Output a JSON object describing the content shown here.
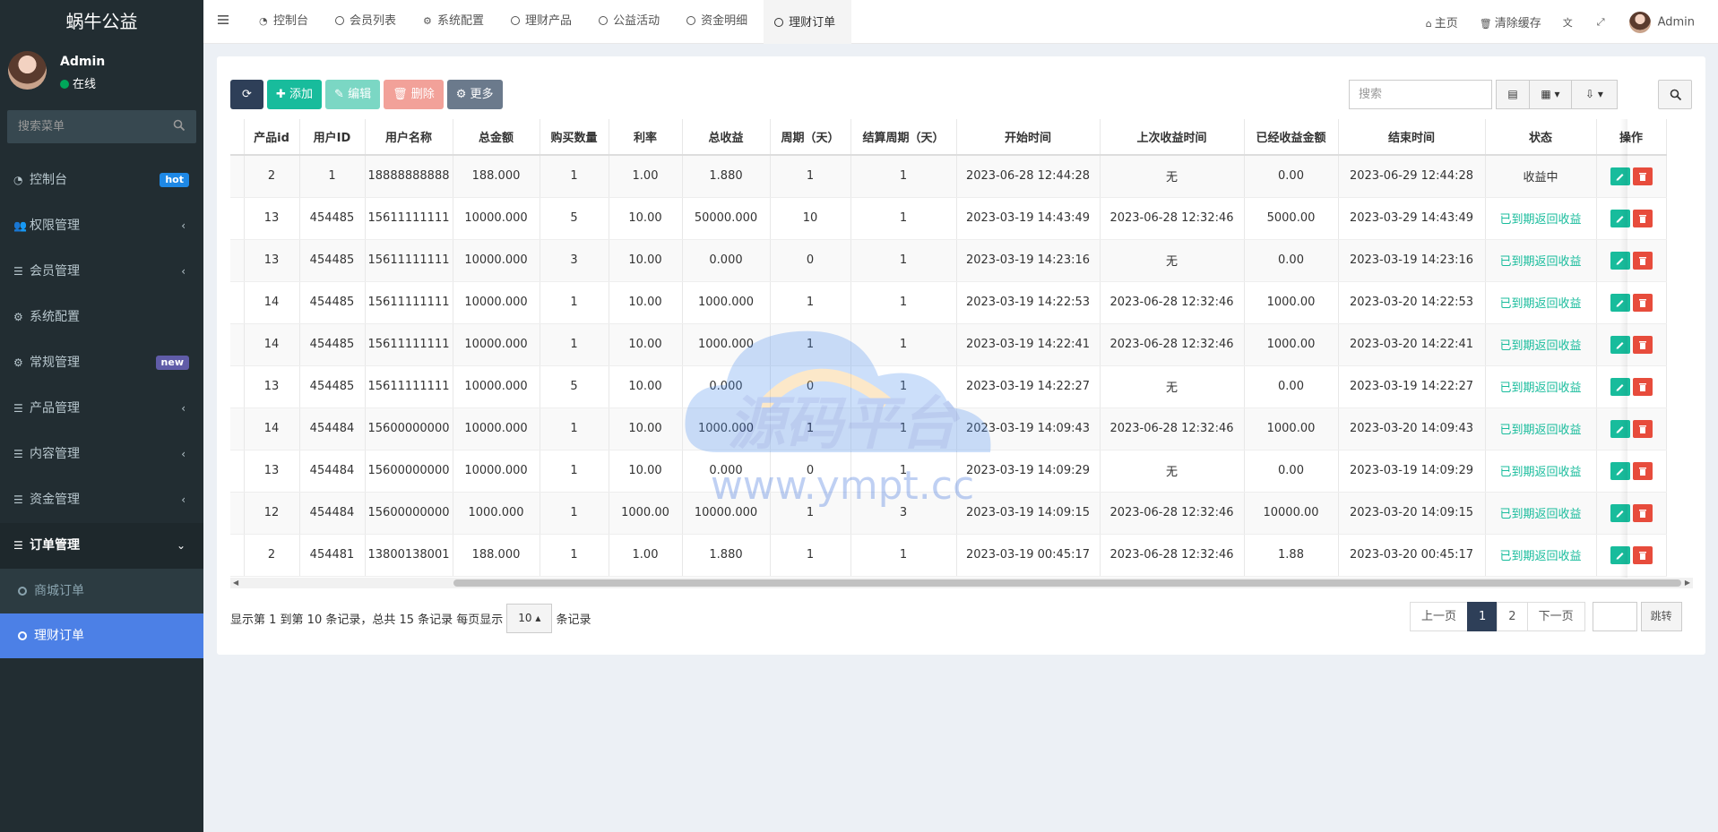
{
  "app": {
    "title": "蜗牛公益"
  },
  "user": {
    "name": "Admin",
    "status": "在线"
  },
  "sidebar": {
    "search_placeholder": "搜索菜单",
    "items": [
      {
        "icon": "dashboard-icon",
        "label": "控制台",
        "badge": "hot"
      },
      {
        "icon": "users-icon",
        "label": "权限管理",
        "chevron": "‹"
      },
      {
        "icon": "list-icon",
        "label": "会员管理",
        "chevron": "‹"
      },
      {
        "icon": "gear-icon",
        "label": "系统配置"
      },
      {
        "icon": "gears-icon",
        "label": "常规管理",
        "badge": "new"
      },
      {
        "icon": "list-icon",
        "label": "产品管理",
        "chevron": "‹"
      },
      {
        "icon": "list-icon",
        "label": "内容管理",
        "chevron": "‹"
      },
      {
        "icon": "list-icon",
        "label": "资金管理",
        "chevron": "‹"
      },
      {
        "icon": "list-icon",
        "label": "订单管理",
        "chevron": "⌄"
      }
    ],
    "sub_items": [
      {
        "label": "商城订单"
      },
      {
        "label": "理财订单"
      }
    ]
  },
  "topbar": {
    "tabs": [
      {
        "label": "控制台"
      },
      {
        "label": "会员列表"
      },
      {
        "label": "系统配置"
      },
      {
        "label": "理财产品"
      },
      {
        "label": "公益活动"
      },
      {
        "label": "资金明细"
      },
      {
        "label": "理财订单"
      }
    ],
    "home": "主页",
    "clear_cache": "清除缓存",
    "user": "Admin"
  },
  "toolbar": {
    "add": "添加",
    "edit": "编辑",
    "delete": "删除",
    "more": "更多",
    "search_placeholder": "搜索"
  },
  "table": {
    "columns": [
      "产品id",
      "用户ID",
      "用户名称",
      "总金额",
      "购买数量",
      "利率",
      "总收益",
      "周期（天）",
      "结算周期（天）",
      "开始时间",
      "上次收益时间",
      "已经收益金额",
      "结束时间",
      "状态",
      "操作"
    ],
    "rows": [
      [
        "2",
        "1",
        "18888888888",
        "188.000",
        "1",
        "1.00",
        "1.880",
        "1",
        "1",
        "2023-06-28 12:44:28",
        "无",
        "0.00",
        "2023-06-29 12:44:28",
        "收益中"
      ],
      [
        "13",
        "454485",
        "15611111111",
        "10000.000",
        "5",
        "10.00",
        "50000.000",
        "10",
        "1",
        "2023-03-19 14:43:49",
        "2023-06-28 12:32:46",
        "5000.00",
        "2023-03-29 14:43:49",
        "已到期返回收益"
      ],
      [
        "13",
        "454485",
        "15611111111",
        "10000.000",
        "3",
        "10.00",
        "0.000",
        "0",
        "1",
        "2023-03-19 14:23:16",
        "无",
        "0.00",
        "2023-03-19 14:23:16",
        "已到期返回收益"
      ],
      [
        "14",
        "454485",
        "15611111111",
        "10000.000",
        "1",
        "10.00",
        "1000.000",
        "1",
        "1",
        "2023-03-19 14:22:53",
        "2023-06-28 12:32:46",
        "1000.00",
        "2023-03-20 14:22:53",
        "已到期返回收益"
      ],
      [
        "14",
        "454485",
        "15611111111",
        "10000.000",
        "1",
        "10.00",
        "1000.000",
        "1",
        "1",
        "2023-03-19 14:22:41",
        "2023-06-28 12:32:46",
        "1000.00",
        "2023-03-20 14:22:41",
        "已到期返回收益"
      ],
      [
        "13",
        "454485",
        "15611111111",
        "10000.000",
        "5",
        "10.00",
        "0.000",
        "0",
        "1",
        "2023-03-19 14:22:27",
        "无",
        "0.00",
        "2023-03-19 14:22:27",
        "已到期返回收益"
      ],
      [
        "14",
        "454484",
        "15600000000",
        "10000.000",
        "1",
        "10.00",
        "1000.000",
        "1",
        "1",
        "2023-03-19 14:09:43",
        "2023-06-28 12:32:46",
        "1000.00",
        "2023-03-20 14:09:43",
        "已到期返回收益"
      ],
      [
        "13",
        "454484",
        "15600000000",
        "10000.000",
        "1",
        "10.00",
        "0.000",
        "0",
        "1",
        "2023-03-19 14:09:29",
        "无",
        "0.00",
        "2023-03-19 14:09:29",
        "已到期返回收益"
      ],
      [
        "12",
        "454484",
        "15600000000",
        "1000.000",
        "1",
        "1000.00",
        "10000.000",
        "1",
        "3",
        "2023-03-19 14:09:15",
        "2023-06-28 12:32:46",
        "10000.00",
        "2023-03-20 14:09:15",
        "已到期返回收益"
      ],
      [
        "2",
        "454481",
        "13800138001",
        "188.000",
        "1",
        "1.00",
        "1.880",
        "1",
        "1",
        "2023-03-19 00:45:17",
        "2023-06-28 12:32:46",
        "1.88",
        "2023-03-20 00:45:17",
        "已到期返回收益"
      ]
    ]
  },
  "pagination": {
    "info_prefix": "显示第 1 到第 10 条记录，总共 15 条记录 每页显示",
    "page_size": "10",
    "info_suffix": "条记录",
    "prev": "上一页",
    "pages": [
      "1",
      "2"
    ],
    "next": "下一页",
    "jump": "跳转"
  },
  "watermark": {
    "text": "源码平台",
    "url": "www.ympt.cc"
  },
  "colors": {
    "sidebar_bg": "#222d32",
    "accent": "#18bc9c",
    "selected": "#4c80e6",
    "danger": "#e74c3c"
  }
}
